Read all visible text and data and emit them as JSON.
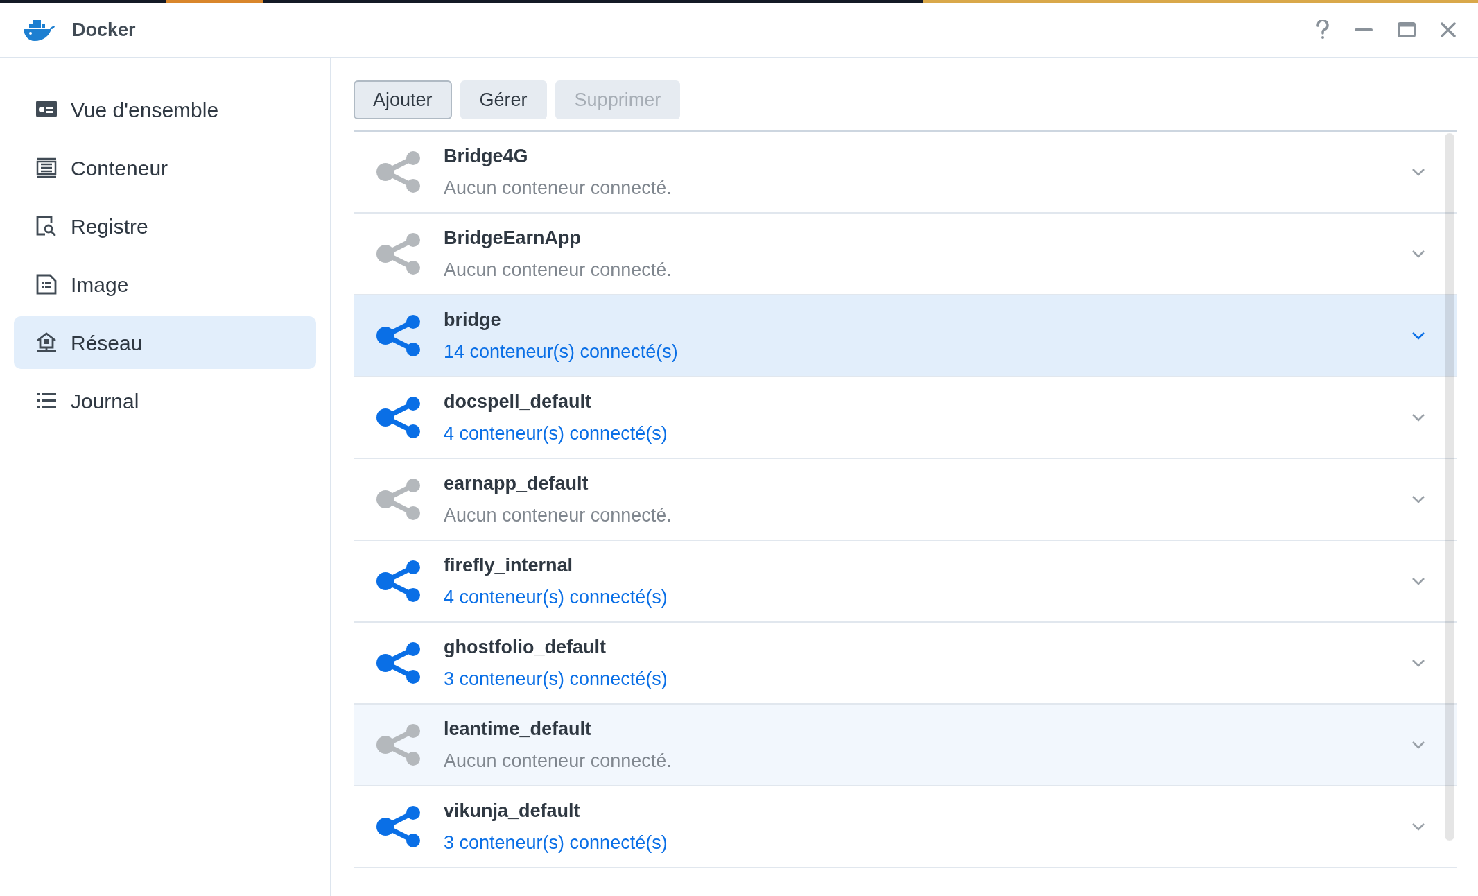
{
  "window": {
    "title": "Docker"
  },
  "sidebar": {
    "items": [
      {
        "label": "Vue d'ensemble",
        "selected": false
      },
      {
        "label": "Conteneur",
        "selected": false
      },
      {
        "label": "Registre",
        "selected": false
      },
      {
        "label": "Image",
        "selected": false
      },
      {
        "label": "Réseau",
        "selected": true
      },
      {
        "label": "Journal",
        "selected": false
      }
    ]
  },
  "toolbar": [
    {
      "label": "Ajouter",
      "disabled": false,
      "focused": true
    },
    {
      "label": "Gérer",
      "disabled": false,
      "focused": false
    },
    {
      "label": "Supprimer",
      "disabled": true,
      "focused": false
    }
  ],
  "networks": [
    {
      "name": "Bridge4G",
      "status": "Aucun conteneur connecté.",
      "connected": false,
      "selected": false,
      "hovered": false
    },
    {
      "name": "BridgeEarnApp",
      "status": "Aucun conteneur connecté.",
      "connected": false,
      "selected": false,
      "hovered": false
    },
    {
      "name": "bridge",
      "status": "14 conteneur(s) connecté(s)",
      "connected": true,
      "selected": true,
      "hovered": false
    },
    {
      "name": "docspell_default",
      "status": "4 conteneur(s) connecté(s)",
      "connected": true,
      "selected": false,
      "hovered": false
    },
    {
      "name": "earnapp_default",
      "status": "Aucun conteneur connecté.",
      "connected": false,
      "selected": false,
      "hovered": false
    },
    {
      "name": "firefly_internal",
      "status": "4 conteneur(s) connecté(s)",
      "connected": true,
      "selected": false,
      "hovered": false
    },
    {
      "name": "ghostfolio_default",
      "status": "3 conteneur(s) connecté(s)",
      "connected": true,
      "selected": false,
      "hovered": false
    },
    {
      "name": "leantime_default",
      "status": "Aucun conteneur connecté.",
      "connected": false,
      "selected": false,
      "hovered": true
    },
    {
      "name": "vikunja_default",
      "status": "3 conteneur(s) connecté(s)",
      "connected": true,
      "selected": false,
      "hovered": false
    }
  ]
}
